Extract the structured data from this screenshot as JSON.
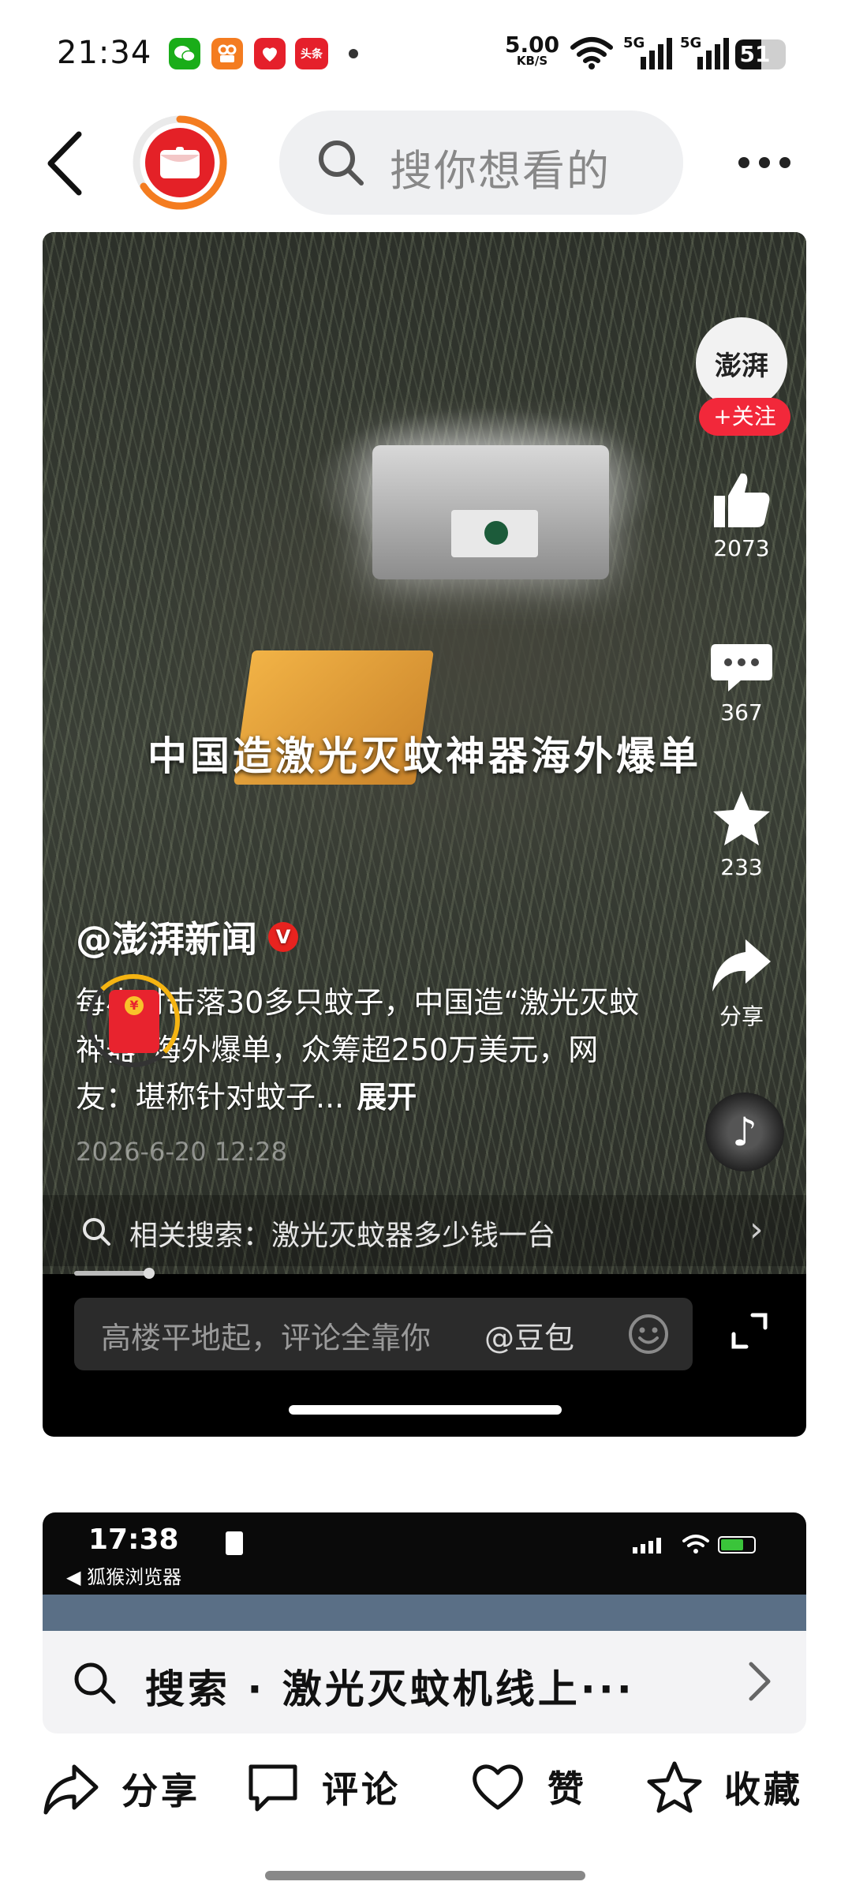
{
  "status_bar": {
    "time": "21:34",
    "toutiao_label": "头条",
    "net_speed": "5.00",
    "net_unit": "KB/S",
    "sim1": "5G",
    "sim2": "5G",
    "battery": "51",
    "battery_level": 0.51
  },
  "header": {
    "search_placeholder": "搜你想看的"
  },
  "video": {
    "overlay_title": "中国造激光灭蚊神器海外爆单",
    "channel_avatar_text": "澎湃",
    "follow_label": "+关注",
    "like_count": "2073",
    "comment_count": "367",
    "favorite_count": "233",
    "share_label": "分享",
    "author": "@澎湃新闻",
    "verified_badge": "V",
    "description": "每小时击落30多只蚊子，中国造“激光灭蚊神器”海外爆单，众筹超250万美元，网友：堪称针对蚊子...",
    "expand_label": "展开",
    "date": "2026-6-20 12:28",
    "related_search": "相关搜索：激光灭蚊器多少钱一台",
    "comment_placeholder": "高楼平地起，评论全靠你",
    "mention": "@豆包"
  },
  "card2": {
    "time": "17:38",
    "browser_label": "◀ 狐猴浏览器"
  },
  "suggestion": {
    "text": "搜索 · 激光灭蚊机线上···"
  },
  "actions": {
    "share": "分享",
    "comment": "评论",
    "like": "赞",
    "favorite": "收藏"
  },
  "colors": {
    "accent_red": "#f2283a",
    "progress_orange": "#f47c20",
    "search_bg": "#eff0f2"
  }
}
